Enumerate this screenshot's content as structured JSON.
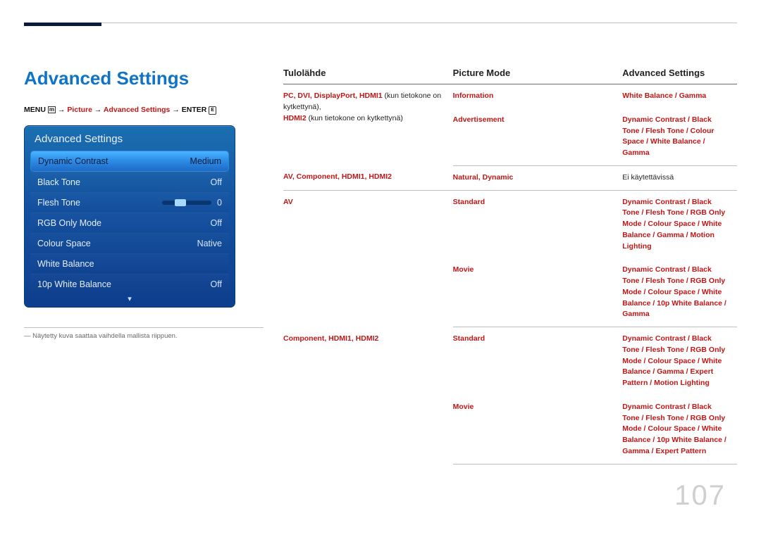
{
  "page": {
    "title": "Advanced Settings",
    "number": "107",
    "footnote": "― Näytetty kuva saattaa vaihdella mallista riippuen."
  },
  "breadcrumb": {
    "menu": "MENU",
    "menu_icon": "m",
    "arrow": " → ",
    "p1": "Picture",
    "p2": "Advanced Settings",
    "enter": "ENTER",
    "enter_icon": "E"
  },
  "panel": {
    "title": "Advanced Settings",
    "rows": {
      "dynamic_contrast": {
        "label": "Dynamic Contrast",
        "value": "Medium"
      },
      "black_tone": {
        "label": "Black Tone",
        "value": "Off"
      },
      "flesh_tone": {
        "label": "Flesh Tone",
        "value": "0"
      },
      "rgb_only": {
        "label": "RGB Only Mode",
        "value": "Off"
      },
      "colour_space": {
        "label": "Colour Space",
        "value": "Native"
      },
      "white_balance": {
        "label": "White Balance",
        "value": ""
      },
      "tenp_wb": {
        "label": "10p White Balance",
        "value": "Off"
      }
    },
    "more": "▾"
  },
  "table": {
    "head": {
      "c1": "Tulolähde",
      "c2": "Picture Mode",
      "c3": "Advanced Settings"
    },
    "r1": {
      "src": "PC, DVI, DisplayPort, HDMI1",
      "src_note1": "(kun tietokone on kytkettynä),",
      "src2": "HDMI2",
      "src_note2": " (kun tietokone on kytkettynä)",
      "mode_a": "Information",
      "mode_b": "Advertisement",
      "set_a": "White Balance / Gamma",
      "set_b": "Dynamic Contrast / Black Tone / Flesh Tone / Colour Space / White Balance / Gamma"
    },
    "r2": {
      "src": "AV, Component, HDMI1, HDMI2",
      "mode": "Natural, Dynamic",
      "set": "Ei käytettävissä"
    },
    "r3": {
      "src": "AV",
      "mode_a": "Standard",
      "mode_b": "Movie",
      "set_a": "Dynamic Contrast / Black Tone / Flesh Tone / RGB Only Mode / Colour Space / White Balance / Gamma / Motion Lighting",
      "set_b": "Dynamic Contrast / Black Tone / Flesh Tone / RGB Only Mode / Colour Space / White Balance / 10p White Balance / Gamma"
    },
    "r4": {
      "src": "Component, HDMI1, HDMI2",
      "mode_a": "Standard",
      "mode_b": "Movie",
      "set_a": "Dynamic Contrast / Black Tone / Flesh Tone / RGB Only Mode / Colour Space / White Balance / Gamma / Expert Pattern / Motion Lighting",
      "set_b": "Dynamic Contrast / Black Tone / Flesh Tone / RGB Only Mode / Colour Space / White Balance / 10p White Balance / Gamma / Expert Pattern"
    }
  }
}
